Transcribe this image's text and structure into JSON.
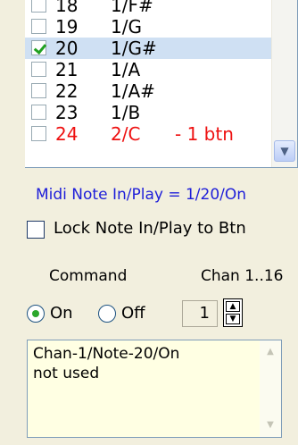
{
  "note_list": {
    "rows": [
      {
        "num": "18",
        "note": "1/F#",
        "extra": "",
        "checked": false,
        "selected": false,
        "red": false
      },
      {
        "num": "19",
        "note": "1/G",
        "extra": "",
        "checked": false,
        "selected": false,
        "red": false
      },
      {
        "num": "20",
        "note": "1/G#",
        "extra": "",
        "checked": true,
        "selected": true,
        "red": false
      },
      {
        "num": "21",
        "note": "1/A",
        "extra": "",
        "checked": false,
        "selected": false,
        "red": false
      },
      {
        "num": "22",
        "note": "1/A#",
        "extra": "",
        "checked": false,
        "selected": false,
        "red": false
      },
      {
        "num": "23",
        "note": "1/B",
        "extra": "",
        "checked": false,
        "selected": false,
        "red": false
      },
      {
        "num": "24",
        "note": "2/C",
        "extra": "- 1 btn",
        "checked": false,
        "selected": false,
        "red": true
      }
    ]
  },
  "status": "Midi Note In/Play = 1/20/On",
  "lock": {
    "label": "Lock Note In/Play to Btn",
    "checked": false
  },
  "command": {
    "label": "Command",
    "on_label": "On",
    "off_label": "Off",
    "selected": "On"
  },
  "channel": {
    "label": "Chan 1..16",
    "value": "1"
  },
  "message": {
    "text": "Chan-1/Note-20/On\nnot used"
  },
  "colors": {
    "status_text": "#1e1ed9",
    "red_row": "#ee1111",
    "selected_row": "#cfe0f3",
    "panel_bg": "#f2efde",
    "message_bg": "#ffffe3"
  }
}
